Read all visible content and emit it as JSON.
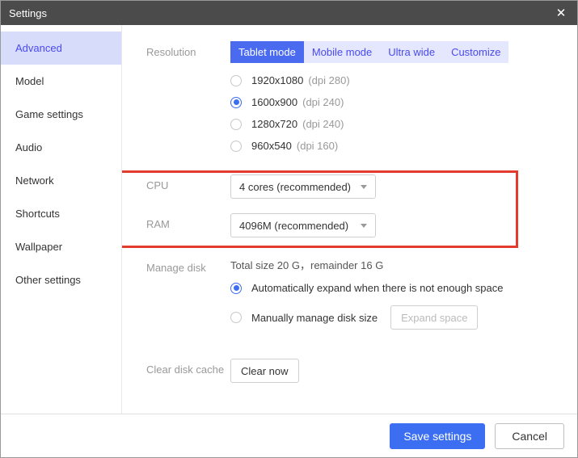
{
  "window": {
    "title": "Settings"
  },
  "sidebar": {
    "items": [
      {
        "label": "Advanced",
        "active": true
      },
      {
        "label": "Model"
      },
      {
        "label": "Game settings"
      },
      {
        "label": "Audio"
      },
      {
        "label": "Network"
      },
      {
        "label": "Shortcuts"
      },
      {
        "label": "Wallpaper"
      },
      {
        "label": "Other settings"
      }
    ]
  },
  "labels": {
    "resolution": "Resolution",
    "cpu": "CPU",
    "ram": "RAM",
    "manage_disk": "Manage disk",
    "clear_cache": "Clear disk cache"
  },
  "modes": [
    {
      "label": "Tablet mode",
      "active": true
    },
    {
      "label": "Mobile mode"
    },
    {
      "label": "Ultra wide"
    },
    {
      "label": "Customize"
    }
  ],
  "resolutions": [
    {
      "res": "1920x1080",
      "dpi": "(dpi 280)",
      "checked": false
    },
    {
      "res": "1600x900",
      "dpi": "(dpi 240)",
      "checked": true
    },
    {
      "res": "1280x720",
      "dpi": "(dpi 240)",
      "checked": false
    },
    {
      "res": "960x540",
      "dpi": "(dpi 160)",
      "checked": false
    }
  ],
  "cpu": {
    "value": "4 cores (recommended)"
  },
  "ram": {
    "value": "4096M (recommended)"
  },
  "disk": {
    "summary": "Total size 20 G，remainder 16 G",
    "options": [
      {
        "label": "Automatically expand when there is not enough space",
        "checked": true
      },
      {
        "label": "Manually manage disk size",
        "checked": false
      }
    ],
    "expand_btn": "Expand space"
  },
  "clear_btn": "Clear now",
  "footer": {
    "save": "Save settings",
    "cancel": "Cancel"
  }
}
